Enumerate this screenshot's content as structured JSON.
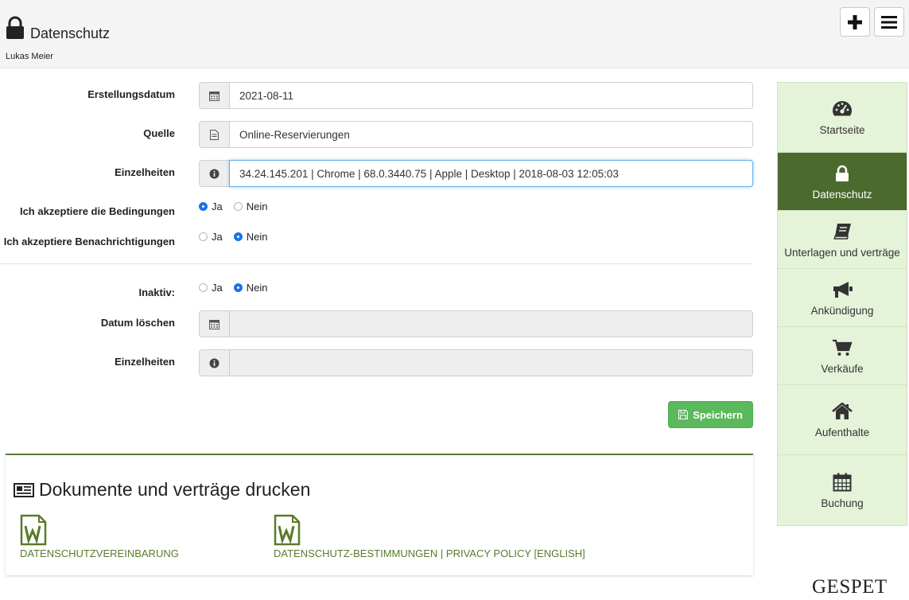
{
  "header": {
    "title": "Datenschutz",
    "user": "Lukas Meier",
    "add_icon": "plus-icon",
    "menu_icon": "menu-icon"
  },
  "form": {
    "created": {
      "label": "Erstellungsdatum",
      "value": "2021-08-11",
      "icon": "calendar-icon"
    },
    "source": {
      "label": "Quelle",
      "value": "Online-Reservierungen",
      "icon": "document-icon"
    },
    "details": {
      "label": "Einzelheiten",
      "value": "34.24.145.201 | Chrome | 68.0.3440.75 | Apple | Desktop | 2018-08-03 12:05:03",
      "icon": "info-icon"
    },
    "accept_terms": {
      "label": "Ich akzeptiere die Bedingungen",
      "yes": "Ja",
      "no": "Nein",
      "selected": "yes"
    },
    "accept_notifications": {
      "label": "Ich akzeptiere Benachrichtigungen",
      "yes": "Ja",
      "no": "Nein",
      "selected": "no"
    },
    "inactive": {
      "label": "Inaktiv:",
      "yes": "Ja",
      "no": "Nein",
      "selected": "no"
    },
    "delete_date": {
      "label": "Datum löschen",
      "value": "",
      "icon": "calendar-icon"
    },
    "details2": {
      "label": "Einzelheiten",
      "value": "",
      "icon": "info-icon"
    },
    "save_label": "Speichern"
  },
  "documents": {
    "title": "Dokumente und verträge drucken",
    "items": [
      {
        "label": "DATENSCHUTZVEREINBARUNG",
        "icon": "word-document-icon"
      },
      {
        "label": "DATENSCHUTZ-BESTIMMUNGEN | PRIVACY POLICY [ENGLISH]",
        "icon": "word-document-icon"
      }
    ]
  },
  "sidebar": {
    "items": [
      {
        "label": "Startseite",
        "icon": "dashboard-icon",
        "active": false
      },
      {
        "label": "Datenschutz",
        "icon": "lock-icon",
        "active": true
      },
      {
        "label": "Unterlagen und verträge",
        "icon": "book-icon",
        "active": false
      },
      {
        "label": "Ankündigung",
        "icon": "megaphone-icon",
        "active": false
      },
      {
        "label": "Verkäufe",
        "icon": "cart-icon",
        "active": false
      },
      {
        "label": "Aufenthalte",
        "icon": "home-icon",
        "active": false
      },
      {
        "label": "Buchung",
        "icon": "calendar-icon",
        "active": false
      }
    ]
  },
  "colors": {
    "accent_green": "#4a6a2e",
    "sidebar_bg": "#e5f3d9",
    "save_green": "#5cb85c",
    "radio_blue": "#1a73e8",
    "link_green": "#5a7a2a"
  },
  "brand": "GESPET"
}
